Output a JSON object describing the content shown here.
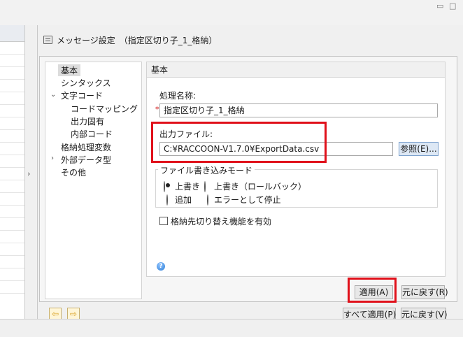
{
  "editor": {
    "title": "メッセージ設定　（指定区切り子_1_格納）",
    "icon": "document-icon"
  },
  "nav": {
    "items": [
      {
        "label": "基本",
        "selected": true
      },
      {
        "label": "シンタックス"
      },
      {
        "label": "文字コード",
        "expanded": true
      },
      {
        "label": "コードマッピング"
      },
      {
        "label": "出力固有"
      },
      {
        "label": "内部コード"
      },
      {
        "label": "格納処理変数"
      },
      {
        "label": "外部データ型",
        "expanded": false
      },
      {
        "label": "その他"
      }
    ]
  },
  "panel": {
    "section_title": "基本",
    "process_name_label": "処理名称:",
    "required_mark": "*",
    "process_name_value": "指定区切り子_1_格納",
    "output_file_label": "出力ファイル:",
    "output_file_value": "C:¥RACCOON-V1.7.0¥ExportData.csv",
    "browse_button": "参照(E)...",
    "write_mode": {
      "title": "ファイル書き込みモード",
      "options": [
        {
          "label": "上書き",
          "selected": true
        },
        {
          "label": "上書き（ロールバック）",
          "selected": false
        },
        {
          "label": "追加",
          "selected": false
        },
        {
          "label": "エラーとして停止",
          "selected": false
        }
      ]
    },
    "switch_destination_label": "格納先切り替え機能を有効",
    "switch_destination_checked": false
  },
  "buttons": {
    "apply": "適用(A)",
    "restore": "元に戻す(R)",
    "apply_all": "すべて適用(P)",
    "restore_all": "元に戻す(V)"
  },
  "colors": {
    "highlight": "#e0101a",
    "accent": "#2f7fd6"
  }
}
